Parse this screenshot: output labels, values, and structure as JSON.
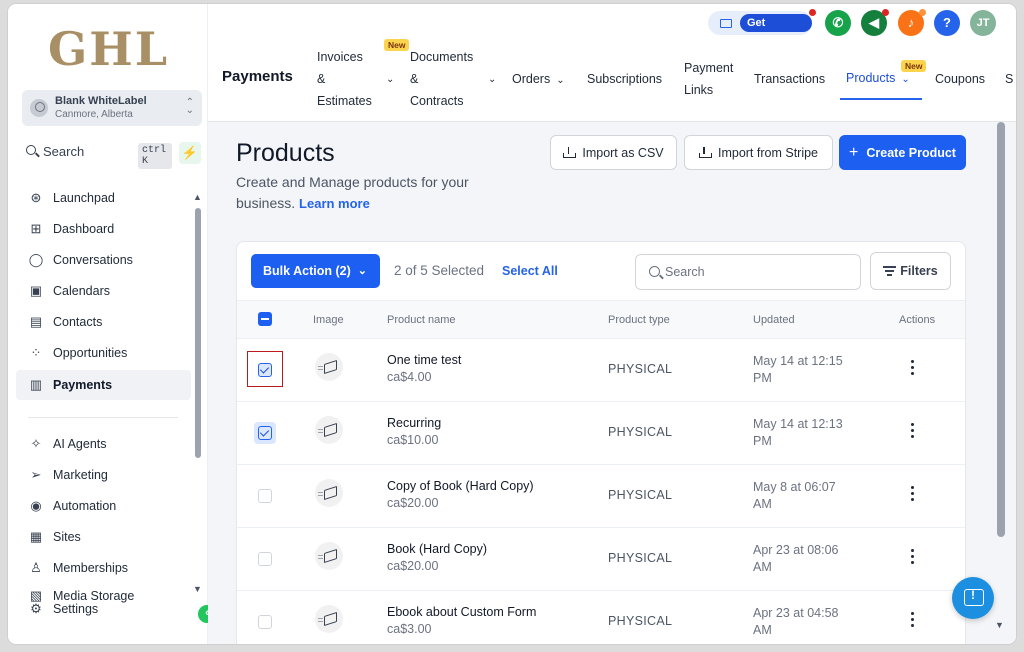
{
  "sidebar": {
    "logo": "GHL",
    "account": {
      "name": "Blank WhiteLabel",
      "location": "Canmore, Alberta"
    },
    "search": {
      "label": "Search",
      "shortcut": "ctrl K"
    },
    "items": [
      {
        "label": "Launchpad",
        "icon": "rocket-icon"
      },
      {
        "label": "Dashboard",
        "icon": "dashboard-icon"
      },
      {
        "label": "Conversations",
        "icon": "chat-icon"
      },
      {
        "label": "Calendars",
        "icon": "calendar-icon"
      },
      {
        "label": "Contacts",
        "icon": "contacts-icon"
      },
      {
        "label": "Opportunities",
        "icon": "opportunities-icon"
      },
      {
        "label": "Payments",
        "icon": "payments-icon",
        "active": true
      },
      {
        "label": "AI Agents",
        "icon": "sparkle-icon"
      },
      {
        "label": "Marketing",
        "icon": "send-icon"
      },
      {
        "label": "Automation",
        "icon": "automation-icon"
      },
      {
        "label": "Sites",
        "icon": "sites-icon"
      },
      {
        "label": "Memberships",
        "icon": "membership-icon"
      },
      {
        "label": "Media Storage",
        "icon": "media-icon"
      },
      {
        "label": "Settings",
        "icon": "gear-icon"
      }
    ]
  },
  "header": {
    "get_started": "Get Started",
    "avatar_initials": "JT",
    "help_symbol": "?",
    "colors": {
      "phone": "#16a34a",
      "megaphone": "#15803d",
      "bell": "#f97316",
      "help": "#2563eb",
      "avatar": "#84b59a"
    },
    "section_title": "Payments",
    "tabs": [
      {
        "label_lines": [
          "Invoices",
          "&",
          "Estimates"
        ],
        "new_badge": "New",
        "dropdown": true
      },
      {
        "label_lines": [
          "Documents",
          "&",
          "Contracts"
        ],
        "dropdown": true
      },
      {
        "label_lines": [
          "Orders"
        ],
        "dropdown": true
      },
      {
        "label_lines": [
          "Subscriptions"
        ]
      },
      {
        "label_lines": [
          "Payment",
          "Links"
        ]
      },
      {
        "label_lines": [
          "Transactions"
        ]
      },
      {
        "label_lines": [
          "Products"
        ],
        "new_badge": "New",
        "dropdown": true,
        "active": true
      },
      {
        "label_lines": [
          "Coupons"
        ]
      },
      {
        "label_lines": [
          "S"
        ]
      }
    ]
  },
  "main": {
    "title": "Products",
    "subtitle": "Create and Manage products for your business.",
    "learn_more": "Learn more",
    "import_csv": "Import as CSV",
    "import_stripe": "Import from Stripe",
    "create_product": "Create Product",
    "bulk_action": "Bulk Action (2)",
    "selected_text": "2 of 5 Selected",
    "select_all": "Select All",
    "search_placeholder": "Search",
    "filters": "Filters",
    "columns": [
      "Image",
      "Product name",
      "Product type",
      "Updated",
      "Actions"
    ],
    "rows": [
      {
        "name": "One time test",
        "price": "ca$4.00",
        "type": "PHYSICAL",
        "updated_l1": "May 14 at 12:15",
        "updated_l2": "PM",
        "checked": true
      },
      {
        "name": "Recurring",
        "price": "ca$10.00",
        "type": "PHYSICAL",
        "updated_l1": "May 14 at 12:13",
        "updated_l2": "PM",
        "checked": true
      },
      {
        "name": "Copy of Book (Hard Copy)",
        "price": "ca$20.00",
        "type": "PHYSICAL",
        "updated_l1": "May 8 at 06:07",
        "updated_l2": "AM",
        "checked": false
      },
      {
        "name": "Book (Hard Copy)",
        "price": "ca$20.00",
        "type": "PHYSICAL",
        "updated_l1": "Apr 23 at 08:06",
        "updated_l2": "AM",
        "checked": false
      },
      {
        "name": "Ebook about Custom Form",
        "price": "ca$3.00",
        "type": "PHYSICAL",
        "updated_l1": "Apr 23 at 04:58",
        "updated_l2": "AM",
        "checked": false
      }
    ]
  }
}
